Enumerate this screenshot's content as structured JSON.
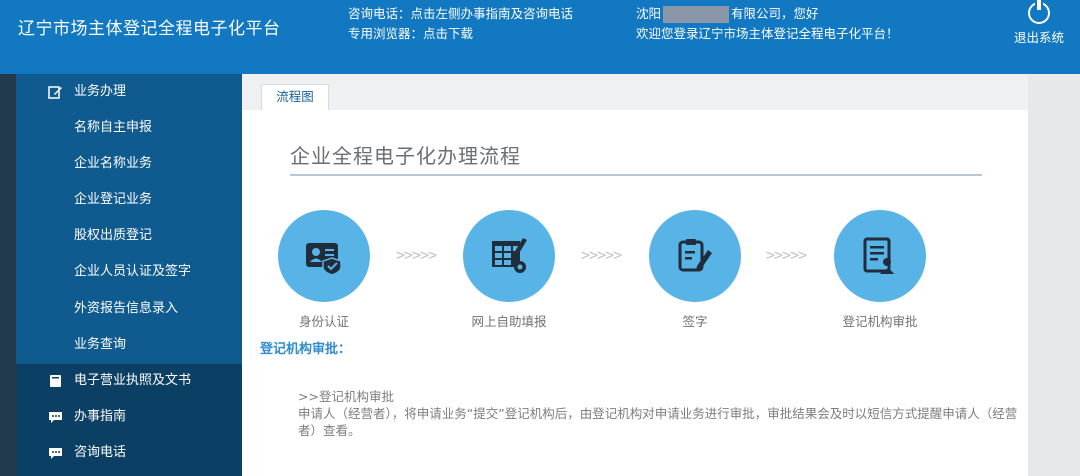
{
  "header": {
    "title": "辽宁市场主体登记全程电子化平台",
    "hotline": "咨询电话：点击左侧办事指南及咨询电话",
    "browser": "专用浏览器：点击下载",
    "greeting_prefix": "沈阳",
    "greeting_suffix": "有限公司，您好",
    "welcome": "欢迎您登录辽宁市场主体登记全程电子化平台！",
    "logout_label": "退出系统"
  },
  "sidebar": {
    "section_business": "业务办理",
    "sub_items": [
      "名称自主申报",
      "企业名称业务",
      "企业登记业务",
      "股权出质登记",
      "企业人员认证及签字",
      "外资报告信息录入",
      "业务查询"
    ],
    "license": "电子营业执照及文书",
    "guide": "办事指南",
    "phone": "咨询电话"
  },
  "tabs": {
    "active": "流程图"
  },
  "flow": {
    "title": "企业全程电子化办理流程",
    "arrows": ">>>>>",
    "steps": [
      {
        "label": "身份认证",
        "icon": "id-card-icon"
      },
      {
        "label": "网上自助填报",
        "icon": "form-edit-icon"
      },
      {
        "label": "签字",
        "icon": "sign-icon"
      },
      {
        "label": "登记机构审批",
        "icon": "document-approval-icon"
      }
    ]
  },
  "detail": {
    "heading": "登记机构审批：",
    "subheading": ">>登记机构审批",
    "text": "申请人（经营者），将申请业务“提交”登记机构后，由登记机构对申请业务进行审批，审批结果会及时以短信方式提醒申请人（经营者）查看。"
  },
  "colors": {
    "header": "#1178c1",
    "sidebar": "#0f5a8f",
    "accent": "#58b4e6"
  }
}
